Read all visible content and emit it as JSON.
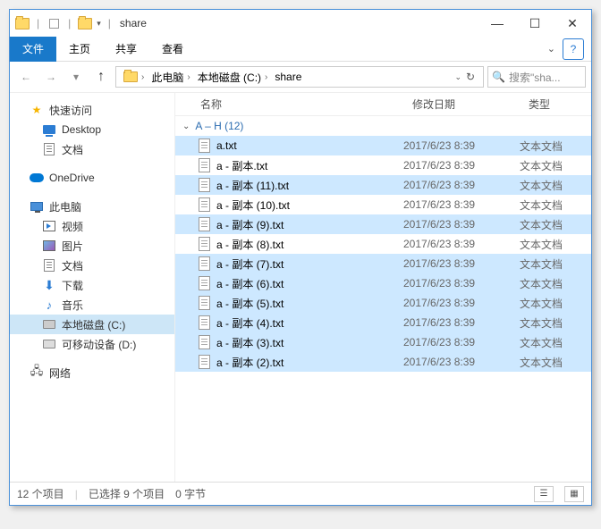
{
  "window": {
    "title": "share",
    "controls": {
      "min": "—",
      "max": "☐",
      "close": "✕"
    }
  },
  "ribbon": {
    "file": "文件",
    "home": "主页",
    "share": "共享",
    "view": "查看",
    "help": "?"
  },
  "nav": {
    "back": "←",
    "forward": "→",
    "dropdown": "▾",
    "up": "↑",
    "crumbs": [
      "此电脑",
      "本地磁盘 (C:)",
      "share"
    ],
    "refresh": "↻",
    "search_placeholder": "搜索\"sha..."
  },
  "sidebar": {
    "quick": "快速访问",
    "desktop": "Desktop",
    "documents": "文档",
    "onedrive": "OneDrive",
    "thispc": "此电脑",
    "videos": "视频",
    "pictures": "图片",
    "docs2": "文档",
    "downloads": "下载",
    "music": "音乐",
    "localdisk": "本地磁盘 (C:)",
    "removable": "可移动设备 (D:)",
    "network": "网络"
  },
  "columns": {
    "name": "名称",
    "date": "修改日期",
    "type": "类型"
  },
  "group": {
    "label": "A – H (12)"
  },
  "files": [
    {
      "name": "a.txt",
      "date": "2017/6/23 8:39",
      "type": "文本文档",
      "sel": true
    },
    {
      "name": "a - 副本.txt",
      "date": "2017/6/23 8:39",
      "type": "文本文档",
      "sel": false
    },
    {
      "name": "a - 副本 (11).txt",
      "date": "2017/6/23 8:39",
      "type": "文本文档",
      "sel": true
    },
    {
      "name": "a - 副本 (10).txt",
      "date": "2017/6/23 8:39",
      "type": "文本文档",
      "sel": false
    },
    {
      "name": "a - 副本 (9).txt",
      "date": "2017/6/23 8:39",
      "type": "文本文档",
      "sel": true
    },
    {
      "name": "a - 副本 (8).txt",
      "date": "2017/6/23 8:39",
      "type": "文本文档",
      "sel": false
    },
    {
      "name": "a - 副本 (7).txt",
      "date": "2017/6/23 8:39",
      "type": "文本文档",
      "sel": true
    },
    {
      "name": "a - 副本 (6).txt",
      "date": "2017/6/23 8:39",
      "type": "文本文档",
      "sel": true
    },
    {
      "name": "a - 副本 (5).txt",
      "date": "2017/6/23 8:39",
      "type": "文本文档",
      "sel": true
    },
    {
      "name": "a - 副本 (4).txt",
      "date": "2017/6/23 8:39",
      "type": "文本文档",
      "sel": true
    },
    {
      "name": "a - 副本 (3).txt",
      "date": "2017/6/23 8:39",
      "type": "文本文档",
      "sel": true
    },
    {
      "name": "a - 副本 (2).txt",
      "date": "2017/6/23 8:39",
      "type": "文本文档",
      "sel": true
    }
  ],
  "status": {
    "count": "12 个项目",
    "selected": "已选择 9 个项目",
    "size": "0 字节"
  }
}
